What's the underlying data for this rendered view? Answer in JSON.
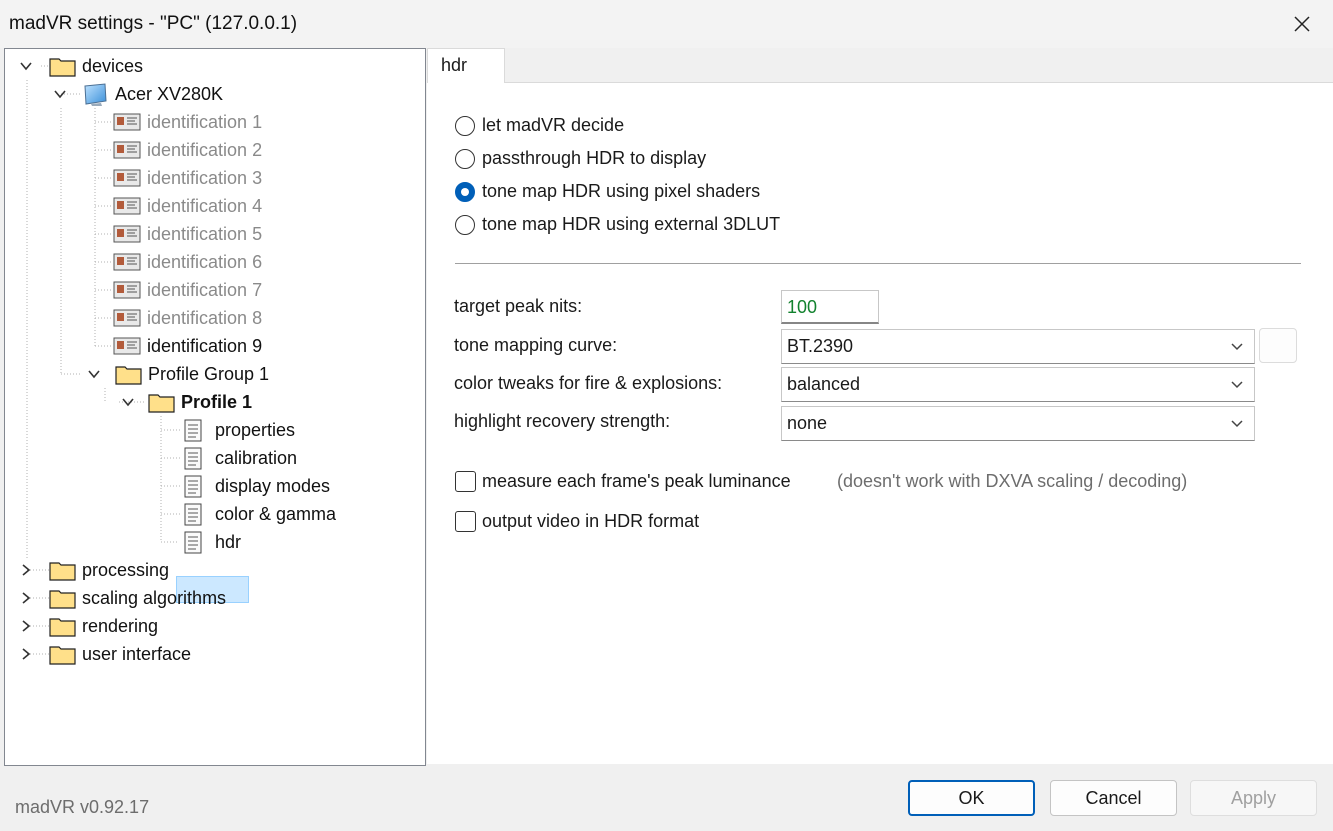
{
  "window": {
    "title": "madVR settings - \"PC\" (127.0.0.1)"
  },
  "tree": {
    "devices": "devices",
    "device_name": "Acer XV280K",
    "identifications": [
      "identification 1",
      "identification 2",
      "identification 3",
      "identification 4",
      "identification 5",
      "identification 6",
      "identification 7",
      "identification 8",
      "identification 9"
    ],
    "profile_group": "Profile Group 1",
    "profile": "Profile 1",
    "profile_items": [
      "properties",
      "calibration",
      "display modes",
      "color & gamma",
      "hdr"
    ],
    "root_items": [
      "processing",
      "scaling algorithms",
      "rendering",
      "user interface"
    ]
  },
  "tab": {
    "label": "hdr"
  },
  "hdr_mode": {
    "options": [
      "let madVR decide",
      "passthrough HDR to display",
      "tone map HDR using pixel shaders",
      "tone map HDR using external 3DLUT"
    ],
    "selected": "tone map HDR using pixel shaders"
  },
  "fields": {
    "target_peak_nits_label": "target peak nits:",
    "target_peak_nits_value": "100",
    "tone_curve_label": "tone mapping curve:",
    "tone_curve_value": "BT.2390",
    "color_tweaks_label": "color tweaks for fire & explosions:",
    "color_tweaks_value": "balanced",
    "highlight_label": "highlight recovery strength:",
    "highlight_value": "none"
  },
  "checks": {
    "measure_label": "measure each frame's peak luminance",
    "measure_note": "(doesn't work with DXVA scaling / decoding)",
    "output_label": "output video in HDR format"
  },
  "footer": {
    "version": "madVR v0.92.17",
    "ok": "OK",
    "cancel": "Cancel",
    "apply": "Apply"
  },
  "colors": {
    "accent": "#005fb8",
    "selection": "#cce8ff",
    "value_green": "#12822e"
  }
}
